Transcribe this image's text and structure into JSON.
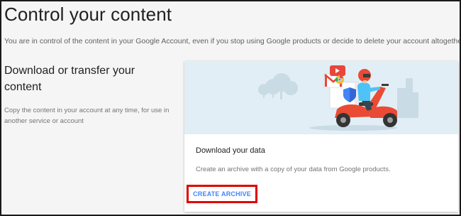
{
  "page": {
    "title": "Control your content",
    "intro": "You are in control of the content in your Google Account, even if you stop using Google products or decide to delete your account altogether."
  },
  "section": {
    "title": "Download or transfer your content",
    "description": "Copy the content in your account at any time, for use in another service or account"
  },
  "card": {
    "illustration": "scooter-rider-with-app-icons",
    "title": "Download your data",
    "description": "Create an archive with a copy of your data from Google products.",
    "action_label": "CREATE ARCHIVE"
  },
  "colors": {
    "accent": "#4285f4",
    "highlight": "#e00000",
    "hero_background": "#e2eef5",
    "scooter": "#e94b35"
  }
}
